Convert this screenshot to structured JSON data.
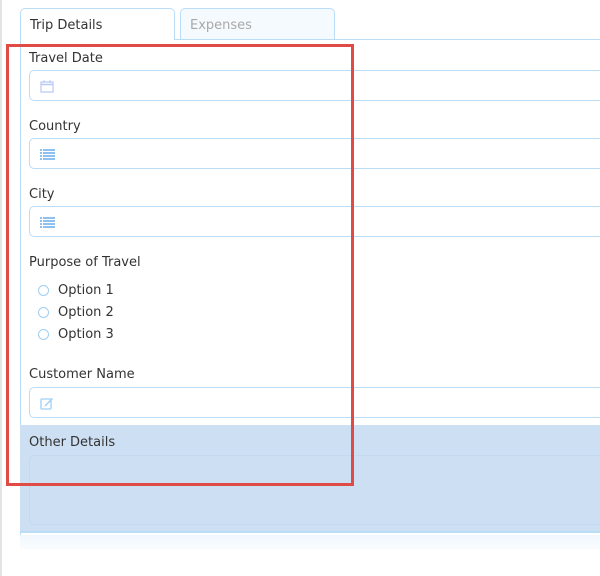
{
  "tabs": [
    {
      "label": "Trip Details",
      "active": true
    },
    {
      "label": "Expenses",
      "active": false
    }
  ],
  "fields": {
    "travel_date": {
      "label": "Travel Date",
      "icon": "calendar-icon"
    },
    "country": {
      "label": "Country",
      "icon": "list-icon"
    },
    "city": {
      "label": "City",
      "icon": "list-icon"
    },
    "purpose": {
      "label": "Purpose of Travel",
      "options": [
        "Option 1",
        "Option 2",
        "Option 3"
      ]
    },
    "customer_name": {
      "label": "Customer Name",
      "icon": "edit-icon"
    },
    "other_details": {
      "label": "Other Details"
    }
  },
  "colors": {
    "accent": "#b9dcf7",
    "highlight": "#cddff2",
    "annotation": "#e04b46"
  }
}
